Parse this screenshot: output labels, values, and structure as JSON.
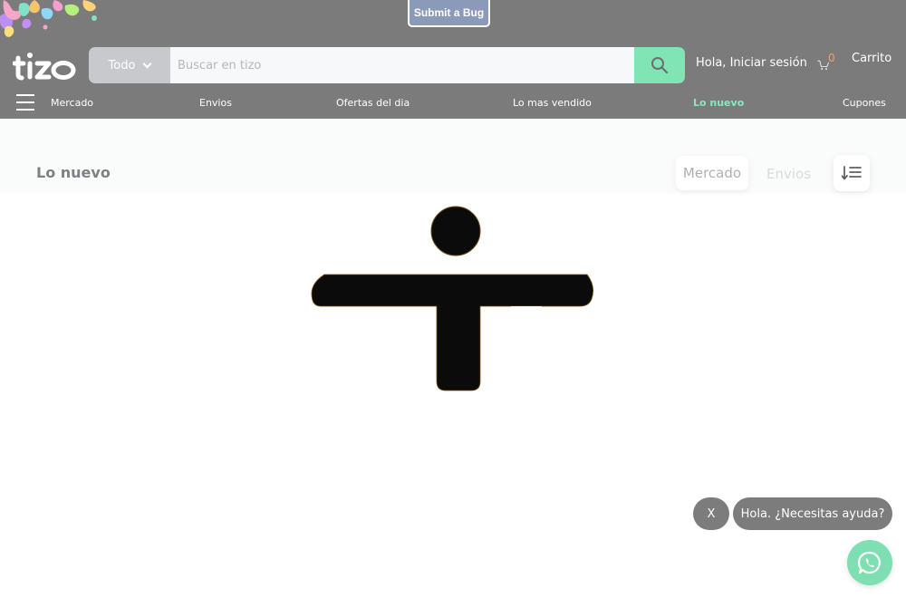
{
  "bug_button": {
    "label": "Submit a Bug"
  },
  "brand": {
    "logo_text": "tizo",
    "accent_color": "#80e4b5",
    "header_color": "#7c7b7c"
  },
  "search": {
    "category": "Todo",
    "placeholder": "Buscar en tizo",
    "value": "",
    "icon": "search-icon"
  },
  "account": {
    "login_label": "Hola, Iniciar sesión"
  },
  "cart": {
    "count": "0",
    "label": "Carrito",
    "icon": "cart-icon"
  },
  "nav": {
    "menu_icon": "hamburger-icon",
    "items": [
      {
        "label": "Mercado"
      },
      {
        "label": "Envios"
      },
      {
        "label": "Ofertas del dia"
      },
      {
        "label": "Lo mas vendido"
      },
      {
        "label": "Lo nuevo",
        "active": true
      },
      {
        "label": "Cupones"
      }
    ]
  },
  "page": {
    "title": "Lo nuevo",
    "filters": [
      {
        "label": "Mercado",
        "selected": true
      },
      {
        "label": "Envios",
        "selected": false
      }
    ],
    "sort_icon": "sort-icon"
  },
  "chat": {
    "close_label": "X",
    "prompt": "Hola. ¿Necesitas ayuda?",
    "whatsapp_icon": "whatsapp-icon"
  }
}
